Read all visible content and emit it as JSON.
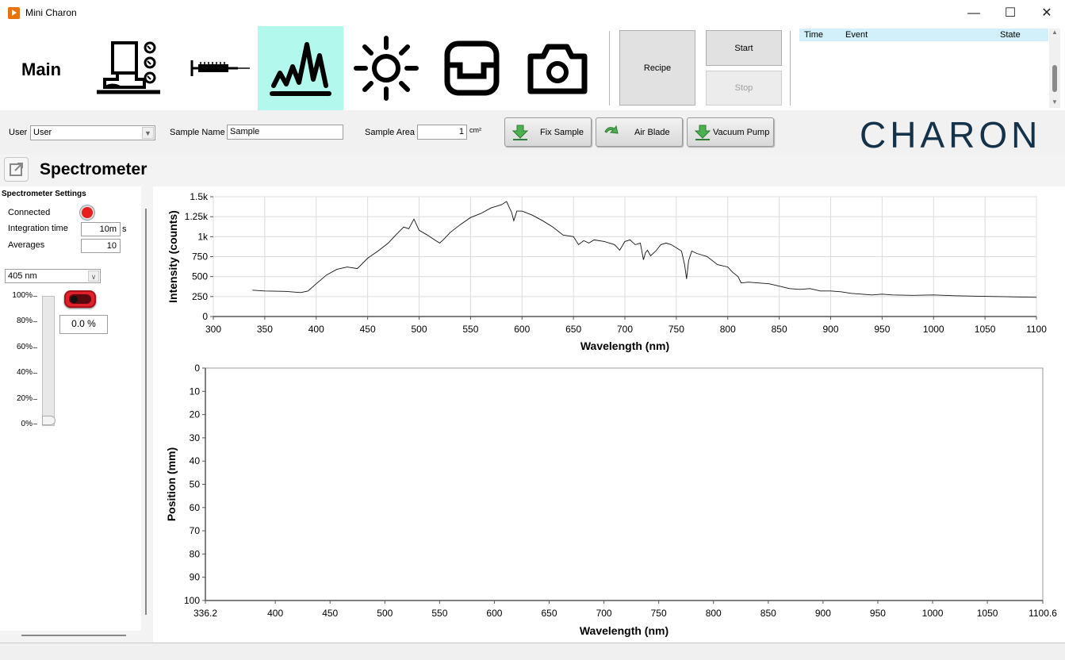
{
  "window": {
    "title": "Mini Charon",
    "minimize": "—",
    "maximize": "☐",
    "close": "✕"
  },
  "ribbon": {
    "main_label": "Main",
    "nav_icons": [
      "machine-icon",
      "syringe-icon",
      "spectrum-icon",
      "light-icon",
      "sample-holder-icon",
      "camera-icon"
    ],
    "selected": "spectrum-icon",
    "recipe_label": "Recipe",
    "start_label": "Start",
    "stop_label": "Stop",
    "eventlog": {
      "headers": [
        "Time",
        "Event",
        "State"
      ]
    }
  },
  "toolbar": {
    "user_label": "User",
    "user_value": "User",
    "sample_name_label": "Sample Name",
    "sample_name_value": "Sample",
    "sample_area_label": "Sample Area",
    "sample_area_value": "1",
    "sample_area_unit": "cm²",
    "fix_sample": "Fix Sample",
    "air_blade": "Air Blade",
    "vacuum_pump": "Vacuum Pump",
    "logo_text": "CHARON"
  },
  "page": {
    "title": "Spectrometer"
  },
  "settings": {
    "title": "Spectrometer Settings",
    "connected_label": "Connected",
    "connected_color": "#e81c1c",
    "integration_label": "Integration time",
    "integration_value": "10m",
    "integration_unit": "s",
    "averages_label": "Averages",
    "averages_value": "10",
    "laser_select": "405 nm",
    "slider_ticks": [
      "100%",
      "80%",
      "60%",
      "40%",
      "20%",
      "0%"
    ],
    "slider_level": 0,
    "power_display": "0.0 %",
    "toggle_on": false
  },
  "chart_data": [
    {
      "type": "line",
      "xlabel": "Wavelength (nm)",
      "ylabel": "Intensity (counts)",
      "xlim": [
        300,
        1100
      ],
      "ylim": [
        0,
        1500
      ],
      "xticks": [
        "300",
        "350",
        "400",
        "450",
        "500",
        "550",
        "600",
        "650",
        "700",
        "750",
        "800",
        "850",
        "900",
        "950",
        "1000",
        "1050",
        "1100"
      ],
      "yticks": [
        "0",
        "250",
        "500",
        "750",
        "1k",
        "1.25k",
        "1.5k"
      ],
      "grid": true,
      "x": [
        338,
        350,
        370,
        385,
        392,
        400,
        410,
        420,
        430,
        440,
        450,
        460,
        470,
        478,
        485,
        490,
        495,
        500,
        508,
        515,
        520,
        525,
        530,
        540,
        550,
        560,
        570,
        575,
        580,
        585,
        590,
        592,
        595,
        600,
        610,
        620,
        630,
        640,
        650,
        655,
        660,
        665,
        670,
        680,
        690,
        695,
        700,
        705,
        710,
        715,
        718,
        720,
        722,
        725,
        730,
        735,
        740,
        745,
        750,
        755,
        758,
        760,
        762,
        765,
        770,
        780,
        790,
        800,
        805,
        810,
        813,
        820,
        830,
        840,
        850,
        860,
        870,
        880,
        890,
        900,
        910,
        920,
        930,
        940,
        950,
        960,
        980,
        1000,
        1020,
        1040,
        1060,
        1080,
        1100
      ],
      "y": [
        330,
        320,
        315,
        300,
        320,
        410,
        520,
        590,
        620,
        600,
        730,
        820,
        920,
        1030,
        1120,
        1100,
        1220,
        1080,
        1020,
        960,
        920,
        980,
        1050,
        1150,
        1240,
        1290,
        1360,
        1380,
        1400,
        1440,
        1300,
        1200,
        1320,
        1320,
        1270,
        1200,
        1120,
        1020,
        1000,
        900,
        950,
        920,
        960,
        940,
        900,
        830,
        940,
        960,
        900,
        920,
        710,
        800,
        830,
        760,
        820,
        900,
        920,
        900,
        860,
        820,
        650,
        470,
        700,
        820,
        790,
        750,
        650,
        620,
        550,
        500,
        420,
        430,
        420,
        410,
        380,
        350,
        340,
        350,
        320,
        320,
        310,
        290,
        280,
        270,
        280,
        270,
        265,
        270,
        260,
        255,
        250,
        245,
        240
      ]
    },
    {
      "type": "heatmap",
      "xlabel": "Wavelength (nm)",
      "ylabel": "Position (mm)",
      "xlim": [
        336.2,
        1100.6
      ],
      "ylim": [
        0,
        100
      ],
      "xticks": [
        "336.2",
        "400",
        "450",
        "500",
        "550",
        "600",
        "650",
        "700",
        "750",
        "800",
        "850",
        "900",
        "950",
        "1000",
        "1050",
        "1100.6"
      ],
      "yticks": [
        "0",
        "10",
        "20",
        "30",
        "40",
        "50",
        "60",
        "70",
        "80",
        "90",
        "100"
      ]
    }
  ]
}
